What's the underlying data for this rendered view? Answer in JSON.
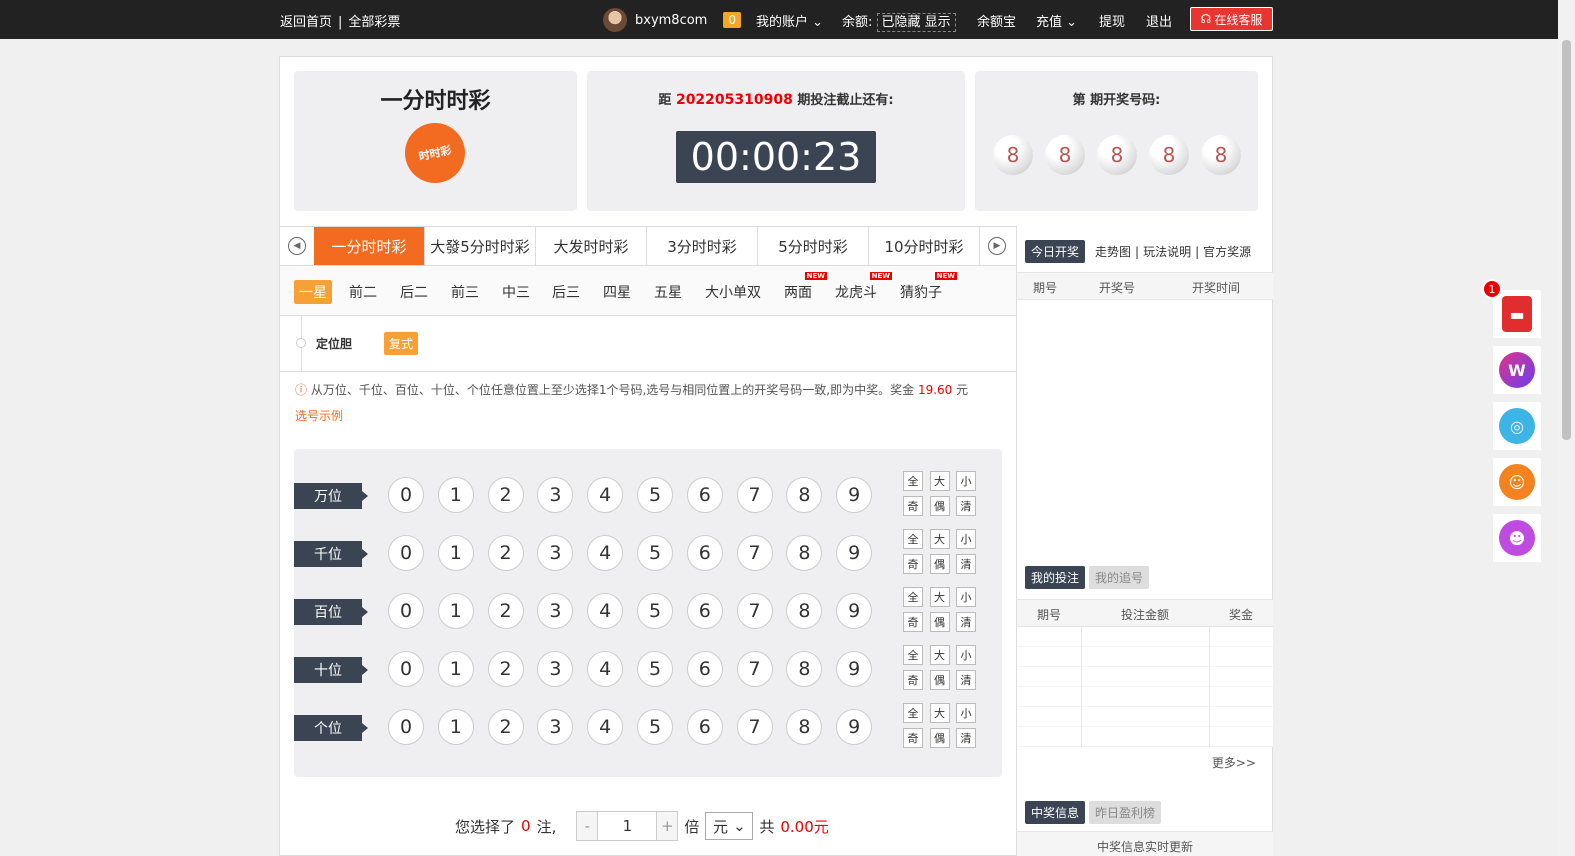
{
  "topbar": {
    "home": "返回首页",
    "all_lottery": "全部彩票",
    "username": "bxym8com",
    "msg_count": "0",
    "my_account": "我的账户",
    "balance_label": "余额:",
    "balance_value": "已隐藏 显示",
    "yuebao": "余额宝",
    "recharge": "充值",
    "withdraw": "提现",
    "logout": "退出",
    "service": "在线客服"
  },
  "lottery": {
    "name": "一分时时彩",
    "logo_text": "时时彩",
    "countdown_prefix": "距",
    "issue": "202205310908",
    "countdown_suffix": "期投注截止还有:",
    "timer": "00:00:23",
    "draw_label": "第  期开奖号码:",
    "draw_balls": [
      "8",
      "8",
      "8",
      "8",
      "8"
    ]
  },
  "game_tabs": [
    "一分时时彩",
    "大發5分时时彩",
    "大发时时彩",
    "3分时时彩",
    "5分时时彩",
    "10分时时彩"
  ],
  "sub_tabs": [
    {
      "label": "一星",
      "new": false
    },
    {
      "label": "前二",
      "new": false
    },
    {
      "label": "后二",
      "new": false
    },
    {
      "label": "前三",
      "new": false
    },
    {
      "label": "中三",
      "new": false
    },
    {
      "label": "后三",
      "new": false
    },
    {
      "label": "四星",
      "new": false
    },
    {
      "label": "五星",
      "new": false
    },
    {
      "label": "大小单双",
      "new": false
    },
    {
      "label": "两面",
      "new": true
    },
    {
      "label": "龙虎斗",
      "new": true
    },
    {
      "label": "猜豹子",
      "new": true
    }
  ],
  "new_tag": "NEW",
  "play": {
    "label": "定位胆",
    "mode": "复式"
  },
  "description": {
    "text": "从万位、千位、百位、十位、个位任意位置上至少选择1个号码,选号与相同位置上的开奖号码一致,即为中奖。奖金",
    "prize": "19.60",
    "unit": "元",
    "example": "选号示例"
  },
  "positions": [
    "万位",
    "千位",
    "百位",
    "十位",
    "个位"
  ],
  "digits": [
    "0",
    "1",
    "2",
    "3",
    "4",
    "5",
    "6",
    "7",
    "8",
    "9"
  ],
  "quick": [
    "全",
    "大",
    "小",
    "奇",
    "偶",
    "清"
  ],
  "footer": {
    "selected_prefix": "您选择了",
    "count": "0",
    "selected_suffix": "注,",
    "minus": "-",
    "multiplier": "1",
    "plus": "+",
    "times": "倍",
    "unit": "元",
    "total_prefix": "共",
    "total": "0.00元"
  },
  "side": {
    "today_draw": "今日开奖",
    "trend": "走势图",
    "rules": "玩法说明",
    "official": "官方奖源",
    "col_issue": "期号",
    "col_number": "开奖号",
    "col_time": "开奖时间",
    "my_bets": "我的投注",
    "my_chase": "我的追号",
    "bet_issue": "期号",
    "bet_amount": "投注金额",
    "bet_prize": "奖金",
    "more": "更多>>",
    "win_info": "中奖信息",
    "yesterday": "昨日盈利榜",
    "realtime": "中奖信息实时更新"
  },
  "floaters": {
    "redpacket_count": "1"
  }
}
